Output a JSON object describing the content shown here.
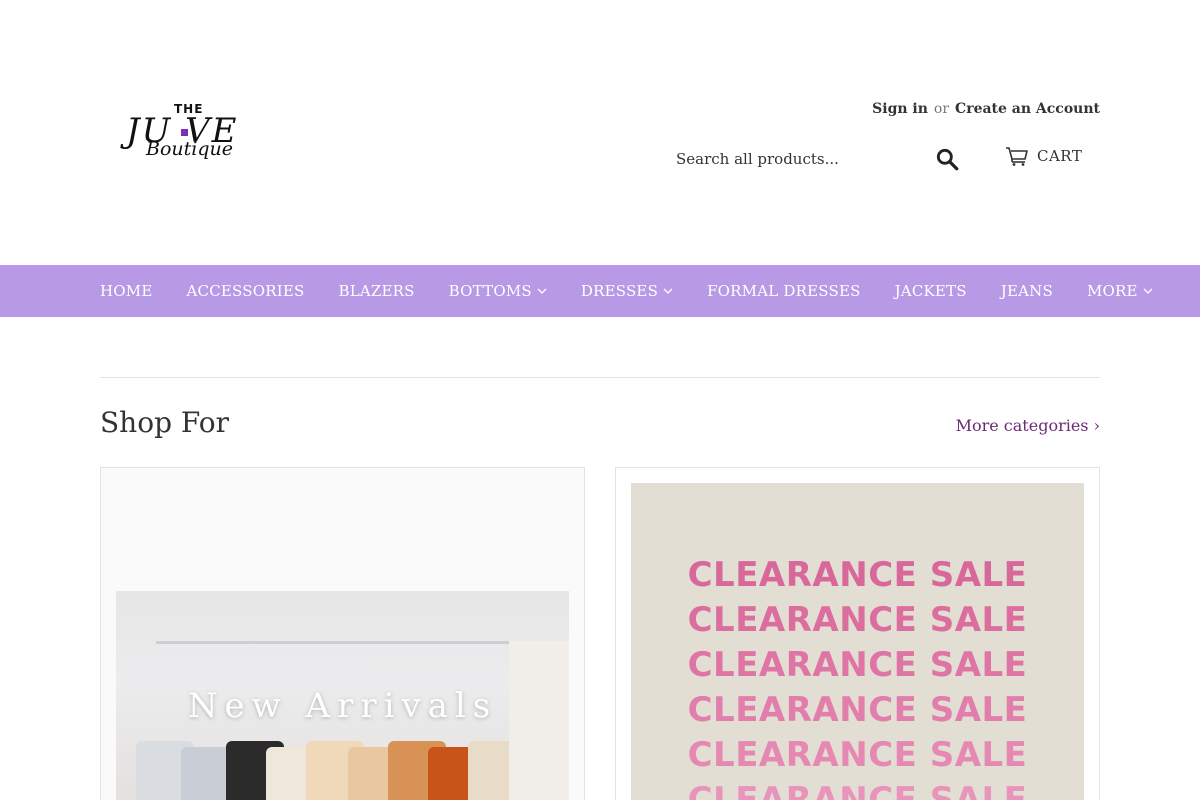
{
  "brand": {
    "logo_top": "THE",
    "logo_main": "JU VE",
    "logo_script": "Boutique",
    "accent_color": "#7a2fb8"
  },
  "account": {
    "sign_in": "Sign in",
    "or": "or",
    "create": "Create an Account"
  },
  "search": {
    "placeholder": "Search all products...",
    "icon": "search-icon"
  },
  "cart": {
    "label": "CART",
    "icon": "cart-icon"
  },
  "nav": {
    "bg_color": "#b899e6",
    "items": [
      {
        "label": "HOME",
        "dropdown": false
      },
      {
        "label": "ACCESSORIES",
        "dropdown": false
      },
      {
        "label": "BLAZERS",
        "dropdown": false
      },
      {
        "label": "BOTTOMS",
        "dropdown": true
      },
      {
        "label": "DRESSES",
        "dropdown": true
      },
      {
        "label": "FORMAL DRESSES",
        "dropdown": false
      },
      {
        "label": "JACKETS",
        "dropdown": false
      },
      {
        "label": "JEANS",
        "dropdown": false
      },
      {
        "label": "MORE",
        "dropdown": true
      }
    ]
  },
  "section": {
    "title": "Shop For",
    "more_link": "More categories ›",
    "link_color": "#6b2a78"
  },
  "cards": [
    {
      "overlay_text": "New Arrivals"
    },
    {
      "lines": [
        "CLEARANCE SALE",
        "CLEARANCE SALE",
        "CLEARANCE SALE",
        "CLEARANCE SALE",
        "CLEARANCE SALE",
        "CLEARANCE SALE"
      ],
      "text_colors": [
        "#d9689a",
        "#dc6e9f",
        "#df75a4",
        "#e27eab",
        "#e589b3",
        "#e894bb"
      ]
    }
  ]
}
